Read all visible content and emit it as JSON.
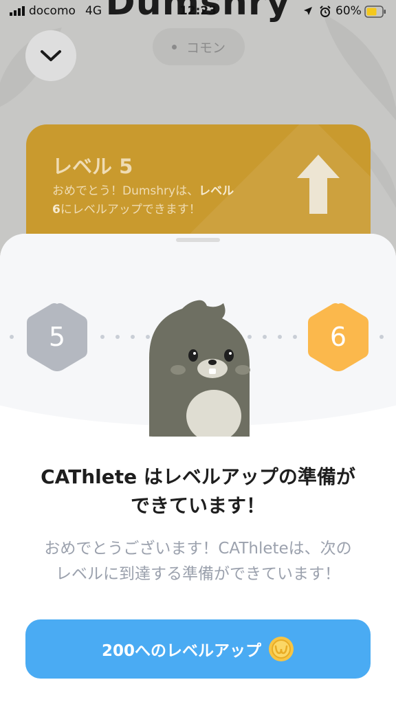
{
  "status_bar": {
    "carrier": "docomo",
    "network": "4G",
    "time": "12:23",
    "battery": "60%"
  },
  "background": {
    "title": "Dumshry",
    "rarity": "コモン",
    "level_card": {
      "title": "レベル 5",
      "text_prefix": "おめでとう！Dumshryは、",
      "text_bold": "レベル 6",
      "text_suffix": "にレベルアップできます！",
      "accent": "#c99a2e"
    }
  },
  "sheet": {
    "current_level": "5",
    "next_level": "6",
    "current_level_color": "#b4b8c0",
    "next_level_color": "#fbb84c",
    "headline_line1": "CAThlete はレベルアップの準備が",
    "headline_line2": "できています！",
    "body_line1": "おめでとうございます！CAThleteは、次の",
    "body_line2": "レベルに到達する準備ができています！",
    "button_label": "200へのレベルアップ",
    "button_color": "#4aabf3",
    "button_icon": "coin-icon"
  }
}
